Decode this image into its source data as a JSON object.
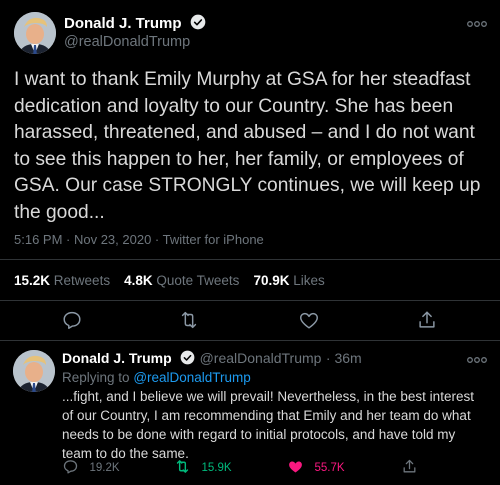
{
  "main_tweet": {
    "author_name": "Donald J. Trump",
    "author_handle": "@realDonaldTrump",
    "text": "I want to thank Emily Murphy at GSA for her steadfast dedication and loyalty to our Country. She has been harassed, threatened, and abused – and I do not want to see this happen to her, her family, or employees of GSA. Our case STRONGLY continues, we will keep up the good...",
    "timestamp": "5:16 PM · Nov 23, 2020 · Twitter for iPhone",
    "retweets_count": "15.2K",
    "retweets_label": "Retweets",
    "quotes_count": "4.8K",
    "quotes_label": "Quote Tweets",
    "likes_count": "70.9K",
    "likes_label": "Likes"
  },
  "reply_tweet": {
    "author_name": "Donald J. Trump",
    "author_handle": "@realDonaldTrump",
    "time_ago": "36m",
    "replying_prefix": "Replying to",
    "replying_to": "@realDonaldTrump",
    "text": "...fight, and I believe we will prevail! Nevertheless, in the best interest of our Country, I am recommending that Emily and her team do what needs to be done with regard to initial protocols, and have told my team to do the same.",
    "reply_count": "19.2K",
    "retweet_count": "15.9K",
    "like_count": "55.7K"
  },
  "colors": {
    "background": "#000000",
    "text": "#d9d9d9",
    "muted": "#6e767d",
    "link": "#1d9bf0",
    "retweet_active": "#00ba7c",
    "like_active": "#f91880"
  }
}
